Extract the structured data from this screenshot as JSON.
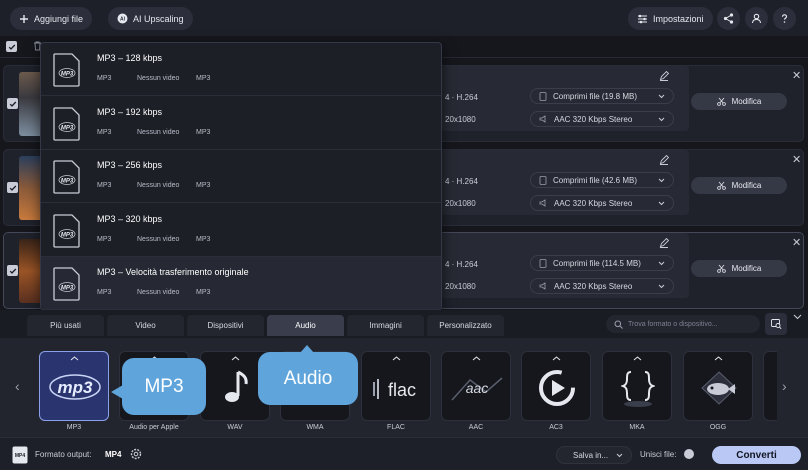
{
  "toolbar": {
    "add_files": "Aggiungi file",
    "ai_upscaling": "AI Upscaling",
    "settings": "Impostazioni"
  },
  "files": [
    {
      "codec": "4 · H.264",
      "resolution": "20x1080",
      "compress": "Comprimi file (19.8 MB)",
      "audio": "AAC 320 Kbps Stereo",
      "edit": "Modifica",
      "selected": false
    },
    {
      "codec": "4 · H.264",
      "resolution": "20x1080",
      "compress": "Comprimi file (42.6 MB)",
      "audio": "AAC 320 Kbps Stereo",
      "edit": "Modifica",
      "selected": false
    },
    {
      "codec": "4 · H.264",
      "resolution": "20x1080",
      "compress": "Comprimi file (114.5 MB)",
      "audio": "AAC 320 Kbps Stereo",
      "edit": "Modifica",
      "selected": true
    }
  ],
  "presets": [
    {
      "title": "MP3 – 128 kbps",
      "video": "Nessun video",
      "format": "MP3",
      "badge": "MP3"
    },
    {
      "title": "MP3 – 192 kbps",
      "video": "Nessun video",
      "format": "MP3",
      "badge": "MP3"
    },
    {
      "title": "MP3 – 256 kbps",
      "video": "Nessun video",
      "format": "MP3",
      "badge": "MP3"
    },
    {
      "title": "MP3 – 320 kbps",
      "video": "Nessun video",
      "format": "MP3",
      "badge": "MP3"
    },
    {
      "title": "MP3 – Velocità trasferimento originale",
      "video": "Nessun video",
      "format": "MP3",
      "badge": "MP3"
    }
  ],
  "tabs": [
    "Più usati",
    "Video",
    "Dispositivi",
    "Audio",
    "Immagini",
    "Personalizzato"
  ],
  "active_tab": "Audio",
  "search": {
    "placeholder": "Trova formato o dispositivo..."
  },
  "formats": [
    {
      "label": "MP3",
      "icon": "mp3-logo-icon",
      "selected": true
    },
    {
      "label": "Audio per Apple",
      "icon": "apple-audio-icon",
      "selected": false
    },
    {
      "label": "WAV",
      "icon": "music-note-icon",
      "selected": false
    },
    {
      "label": "WMA",
      "icon": "wma-icon",
      "selected": false
    },
    {
      "label": "FLAC",
      "icon": "flac-logo-icon",
      "selected": false
    },
    {
      "label": "AAC",
      "icon": "aac-logo-icon",
      "selected": false
    },
    {
      "label": "AC3",
      "icon": "play-circle-icon",
      "selected": false
    },
    {
      "label": "MKA",
      "icon": "braces-icon",
      "selected": false
    },
    {
      "label": "OGG",
      "icon": "fish-icon",
      "selected": false
    }
  ],
  "mp3_logo_text": "mp3",
  "flac_logo_text": "flac",
  "aac_logo_text": "aac",
  "callouts": {
    "mp3": "MP3",
    "audio": "Audio"
  },
  "footer": {
    "output_label": "Formato output:",
    "output_value": "MP4",
    "save_in": "Salva in...",
    "merge": "Unisci file:",
    "convert": "Converti",
    "mp4_badge": "MP4"
  },
  "colors": {
    "accent": "#5fa5dc",
    "selected_format": "#2a3570",
    "convert": "#b9c8f5"
  }
}
